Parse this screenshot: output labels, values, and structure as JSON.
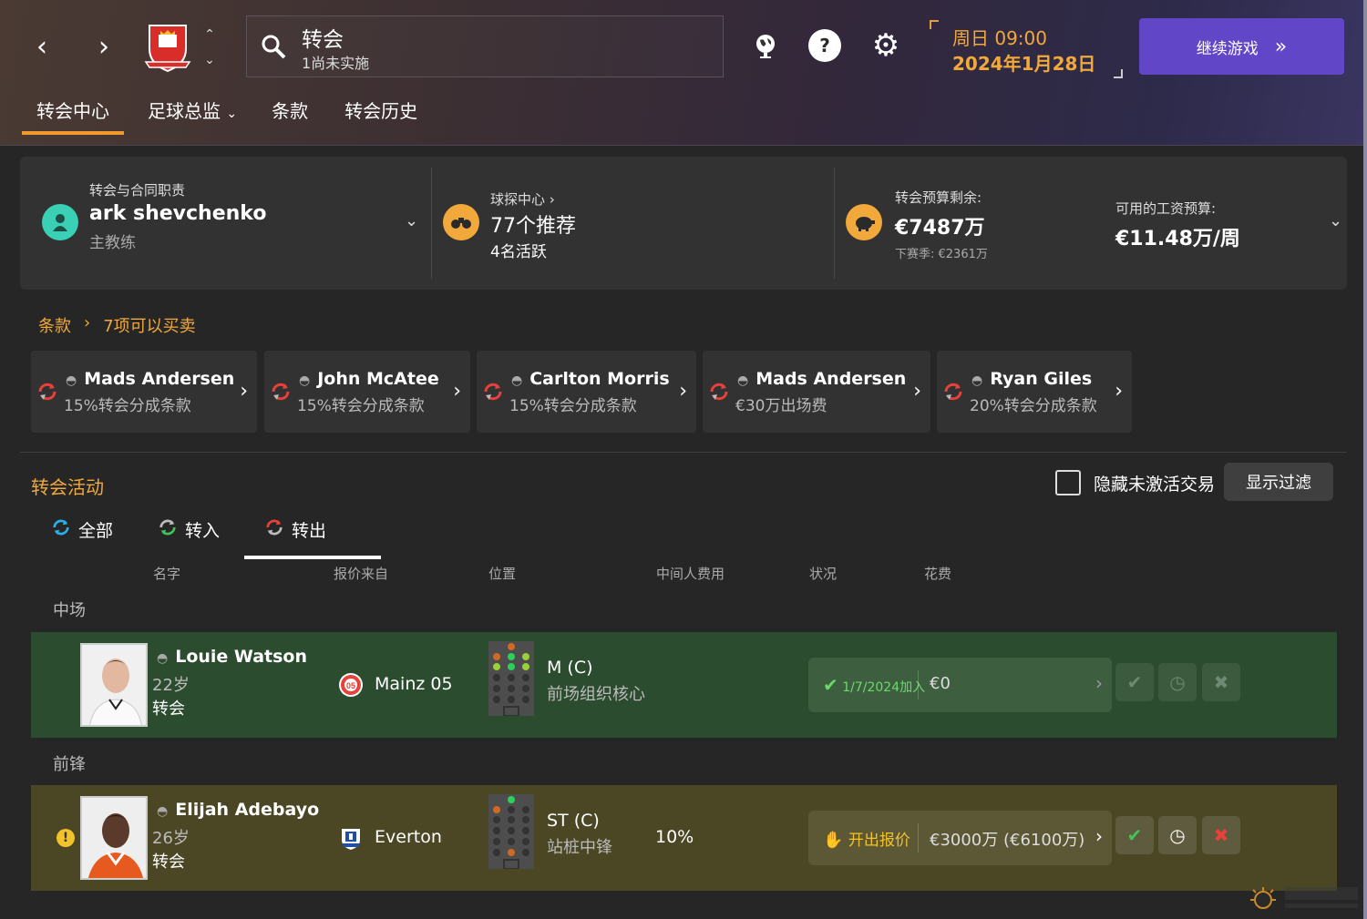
{
  "header": {
    "search_title": "转会",
    "search_sub": "1尚未实施",
    "date_day": "周日 09:00",
    "date_date": "2024年1月28日",
    "continue_label": "继续游戏",
    "tabs": [
      {
        "label": "转会中心"
      },
      {
        "label": "足球总监"
      },
      {
        "label": "条款"
      },
      {
        "label": "转会历史"
      }
    ]
  },
  "summary": {
    "responsibility_label": "转会与合同职责",
    "manager_name": "ark shevchenko",
    "manager_role": "主教练",
    "scouting_label": "球探中心",
    "recommendations": "77个推荐",
    "active": "4名活跃",
    "budget_label": "转会预算剩余:",
    "budget_value": "€7487万",
    "next_season": "下赛季: €2361万",
    "wage_label": "可用的工资预算:",
    "wage_value": "€11.48万/周"
  },
  "clauses": {
    "title": "条款",
    "count_label": "7项可以买卖",
    "items": [
      {
        "name": "Mads Andersen",
        "desc": "15%转会分成条款"
      },
      {
        "name": "John McAtee",
        "desc": "15%转会分成条款"
      },
      {
        "name": "Carlton Morris",
        "desc": "15%转会分成条款"
      },
      {
        "name": "Mads Andersen",
        "desc": "€30万出场费"
      },
      {
        "name": "Ryan Giles",
        "desc": "20%转会分成条款"
      }
    ]
  },
  "activity": {
    "title": "转会活动",
    "hide_inactive": "隐藏未激活交易",
    "show_filter": "显示过滤",
    "subtabs": [
      {
        "label": "全部"
      },
      {
        "label": "转入"
      },
      {
        "label": "转出"
      }
    ],
    "columns": [
      "名字",
      "报价来自",
      "位置",
      "中间人费用",
      "状况",
      "花费"
    ],
    "groups": [
      {
        "label": "中场"
      },
      {
        "label": "前锋"
      }
    ],
    "rows": [
      {
        "name": "Louie Watson",
        "age": "22岁",
        "type": "转会",
        "club": "Mainz 05",
        "position": "M (C)",
        "role": "前场组织核心",
        "agent_fee": "",
        "status": "1/7/2024加入",
        "cost": "€0"
      },
      {
        "name": "Elijah Adebayo",
        "age": "26岁",
        "type": "转会",
        "club": "Everton",
        "position": "ST (C)",
        "role": "站桩中锋",
        "agent_fee": "10%",
        "status": "开出报价",
        "cost": "€3000万 (€6100万)"
      }
    ]
  },
  "colors": {
    "accent_orange": "#f2a93b",
    "continue_purple": "#6246c8",
    "row_green": "#2c4c2f",
    "row_olive": "#4b4624",
    "accept_green": "#3fc35a",
    "reject_red": "#e8403a"
  }
}
